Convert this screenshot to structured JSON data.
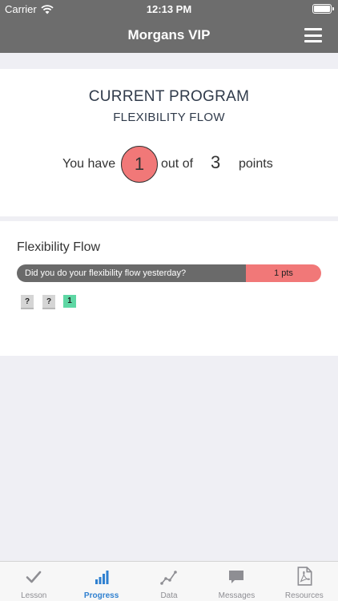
{
  "status_bar": {
    "carrier": "Carrier",
    "time": "12:13 PM"
  },
  "nav": {
    "title": "Morgans VIP",
    "menu_icon": "hamburger-menu-icon"
  },
  "program": {
    "label": "CURRENT PROGRAM",
    "name": "FLEXIBILITY FLOW",
    "points_prefix": "You have",
    "points_current": "1",
    "points_middle": "out of",
    "points_total": "3",
    "points_suffix": "points"
  },
  "habit": {
    "title": "Flexibility Flow",
    "question": "Did you do your flexibility flow yesterday?",
    "points": "1 pts",
    "days": [
      {
        "label": "?",
        "status": "unknown"
      },
      {
        "label": "?",
        "status": "unknown"
      },
      {
        "label": "1",
        "status": "done"
      }
    ]
  },
  "tabs": [
    {
      "label": "Lesson",
      "icon": "checkmark-icon",
      "active": false
    },
    {
      "label": "Progress",
      "icon": "bar-chart-icon",
      "active": true
    },
    {
      "label": "Data",
      "icon": "line-chart-icon",
      "active": false
    },
    {
      "label": "Messages",
      "icon": "chat-bubble-icon",
      "active": false
    },
    {
      "label": "Resources",
      "icon": "pdf-document-icon",
      "active": false
    }
  ],
  "colors": {
    "nav_bg": "#6d6d6d",
    "accent_red": "#f17878",
    "done_green": "#5ed7a4",
    "tab_active": "#2f80d0",
    "tab_inactive": "#8e8e93"
  }
}
